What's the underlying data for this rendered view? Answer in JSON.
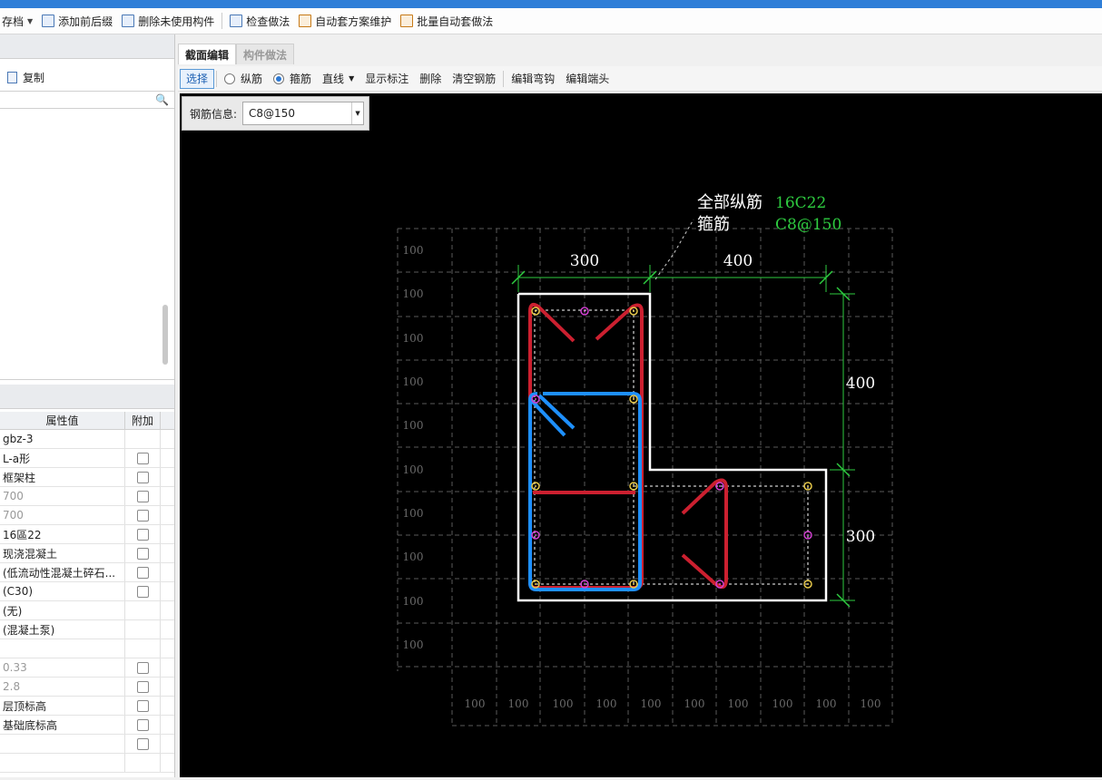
{
  "toolbar": {
    "items": [
      {
        "label": "存档",
        "icon": "save-icon"
      },
      {
        "label": "添加前后缀",
        "icon": "add-prefix-icon"
      },
      {
        "label": "删除未使用构件",
        "icon": "delete-unused-icon"
      },
      {
        "label": "检查做法",
        "icon": "check-method-icon"
      },
      {
        "label": "自动套方案维护",
        "icon": "auto-scheme-icon"
      },
      {
        "label": "批量自动套做法",
        "icon": "batch-auto-icon"
      }
    ]
  },
  "left_panel": {
    "copy_label": "复制",
    "properties": {
      "header_value": "属性值",
      "header_extra": "附加",
      "rows": [
        {
          "value": "gbz-3",
          "has_checkbox": false,
          "gray": false
        },
        {
          "value": "L-a形",
          "has_checkbox": true,
          "gray": false
        },
        {
          "value": "框架柱",
          "has_checkbox": true,
          "gray": false
        },
        {
          "value": "700",
          "has_checkbox": true,
          "gray": true
        },
        {
          "value": "700",
          "has_checkbox": true,
          "gray": true
        },
        {
          "value": "16區22",
          "has_checkbox": true,
          "gray": false
        },
        {
          "value": "现浇混凝土",
          "has_checkbox": true,
          "gray": false
        },
        {
          "value": "(低流动性混凝土碎石...",
          "has_checkbox": true,
          "gray": false
        },
        {
          "value": "(C30)",
          "has_checkbox": true,
          "gray": false
        },
        {
          "value": "(无)",
          "has_checkbox": false,
          "gray": false
        },
        {
          "value": "(混凝土泵)",
          "has_checkbox": false,
          "gray": false
        },
        {
          "value": "",
          "has_checkbox": false,
          "gray": false
        },
        {
          "value": "0.33",
          "has_checkbox": true,
          "gray": true
        },
        {
          "value": "2.8",
          "has_checkbox": true,
          "gray": true
        },
        {
          "value": "层顶标高",
          "has_checkbox": true,
          "gray": false
        },
        {
          "value": "基础底标高",
          "has_checkbox": true,
          "gray": false
        },
        {
          "value": "",
          "has_checkbox": true,
          "gray": false
        },
        {
          "value": "",
          "has_checkbox": false,
          "gray": false
        }
      ]
    }
  },
  "tabs": [
    {
      "label": "截面编辑",
      "active": true
    },
    {
      "label": "构件做法",
      "active": false
    }
  ],
  "edit_toolbar": {
    "select": "选择",
    "longitudinal": "纵筋",
    "stirrup": "箍筋",
    "line": "直线",
    "show_annotation": "显示标注",
    "delete": "删除",
    "clear_rebar": "清空钢筋",
    "edit_hook": "编辑弯钩",
    "edit_end": "编辑端头"
  },
  "rebar_info": {
    "label": "钢筋信息:",
    "value": "C8@150"
  },
  "drawing": {
    "annotation": {
      "long_label": "全部纵筋",
      "long_value": "16C22",
      "stirrup_label": "箍筋",
      "stirrup_value": "C8@150"
    },
    "dims": {
      "top_left": "300",
      "top_right": "400",
      "right_upper": "400",
      "right_lower": "300"
    },
    "grid_label": "100",
    "colors": {
      "red_stirrup": "#cc2030",
      "blue_stirrup": "#1e90ff",
      "dimension": "#2ecc40",
      "outline": "#ffffff",
      "grid": "#5a5a5a",
      "value_text": "#2ecc40"
    }
  }
}
